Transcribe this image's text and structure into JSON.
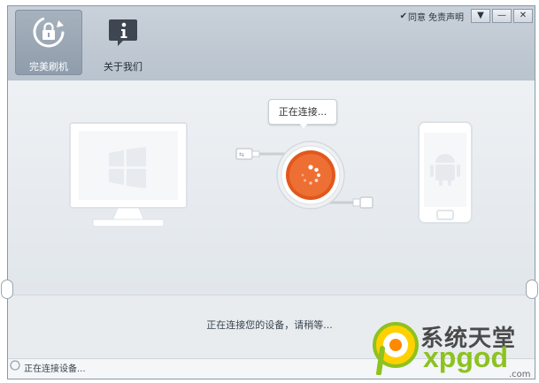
{
  "nav": [
    {
      "label": "完美刷机",
      "icon": "refresh-lock-icon",
      "active": true
    },
    {
      "label": "关于我们",
      "icon": "info-icon",
      "active": false
    }
  ],
  "topbar": {
    "agree_label": "同意",
    "disclaimer_link": "免责声明",
    "menu_btn": "▼",
    "min_btn": "—",
    "close_btn": "✕"
  },
  "bubble_text": "正在连接...",
  "connect_message": "正在连接您的设备，请稍等...",
  "status_text": "正在连接设备...",
  "watermark": {
    "brand_cn": "系统天堂",
    "brand_en": "xpgod",
    "suffix": ".com"
  },
  "colors": {
    "accent_orange": "#e2581c",
    "active_nav": "#95a2b1"
  }
}
